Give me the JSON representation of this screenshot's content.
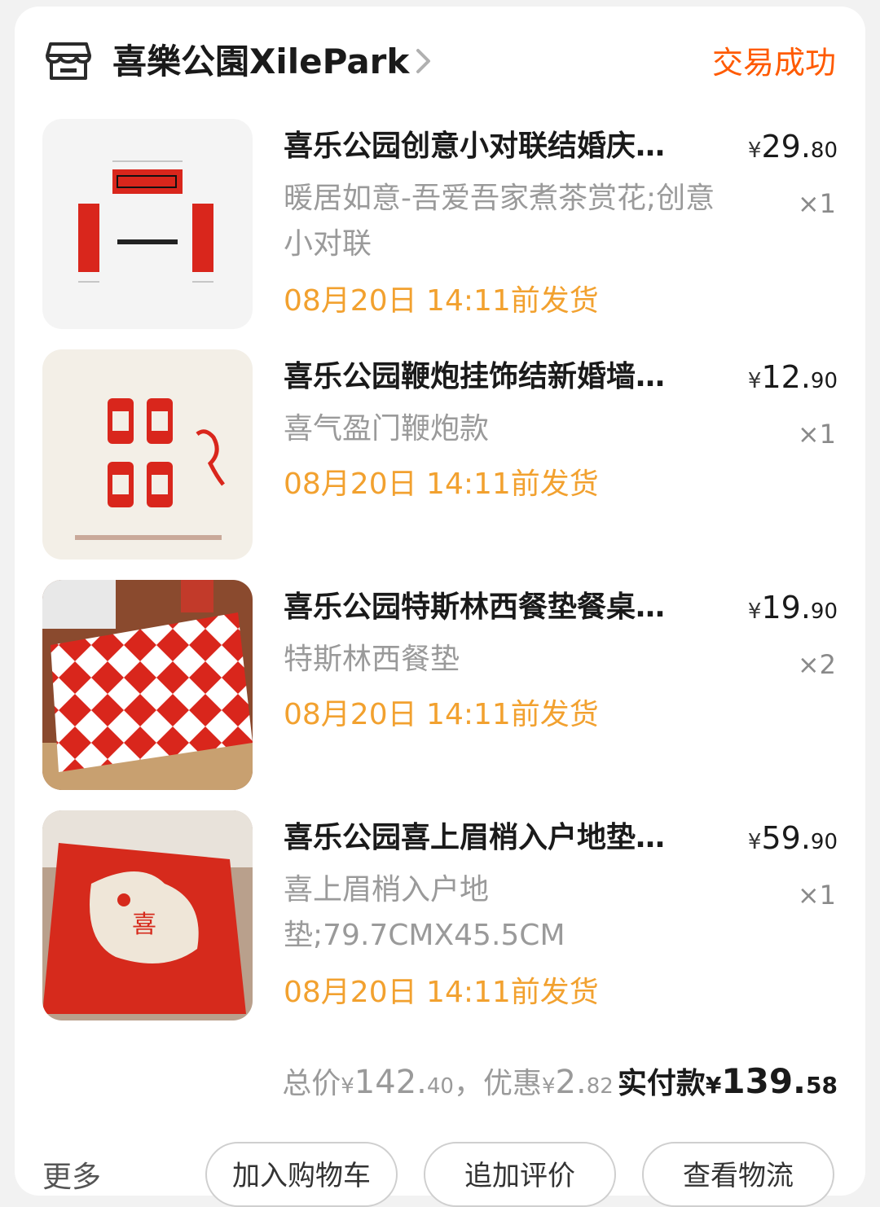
{
  "store": {
    "name": "喜樂公園XilePark",
    "status": "交易成功",
    "icon": "store-icon"
  },
  "items": [
    {
      "title": "喜乐公园创意小对联结婚庆…",
      "sku": "暖居如意-吾爱吾家煮茶赏花;创意小对联",
      "ship": "08月20日 14:11前发货",
      "currency": "¥",
      "price_int": "29.",
      "price_dec": "80",
      "qty": "×1"
    },
    {
      "title": "喜乐公园鞭炮挂饰结新婚墙…",
      "sku": "喜气盈门鞭炮款",
      "ship": "08月20日 14:11前发货",
      "currency": "¥",
      "price_int": "12.",
      "price_dec": "90",
      "qty": "×1"
    },
    {
      "title": "喜乐公园特斯林西餐垫餐桌…",
      "sku": "特斯林西餐垫",
      "ship": "08月20日 14:11前发货",
      "currency": "¥",
      "price_int": "19.",
      "price_dec": "90",
      "qty": "×2"
    },
    {
      "title": "喜乐公园喜上眉梢入户地垫…",
      "sku": "喜上眉梢入户地垫;79.7CMX45.5CM",
      "ship": "08月20日 14:11前发货",
      "currency": "¥",
      "price_int": "59.",
      "price_dec": "90",
      "qty": "×1"
    }
  ],
  "summary": {
    "total_label": "总价",
    "total_cur": "¥",
    "total_int": "142.",
    "total_dec": "40",
    "sep": "，",
    "discount_label": "优惠",
    "discount_cur": "¥",
    "discount_int": "2.",
    "discount_dec": "82",
    "paid_label": "实付款",
    "paid_cur": "¥",
    "paid_int": "139.",
    "paid_dec": "58"
  },
  "actions": {
    "more": "更多",
    "buttons": [
      "加入购物车",
      "追加评价",
      "查看物流"
    ]
  },
  "colors": {
    "status_orange": "#ff5a00",
    "ship_orange": "#f2a12f",
    "festive_red": "#d9261c"
  }
}
